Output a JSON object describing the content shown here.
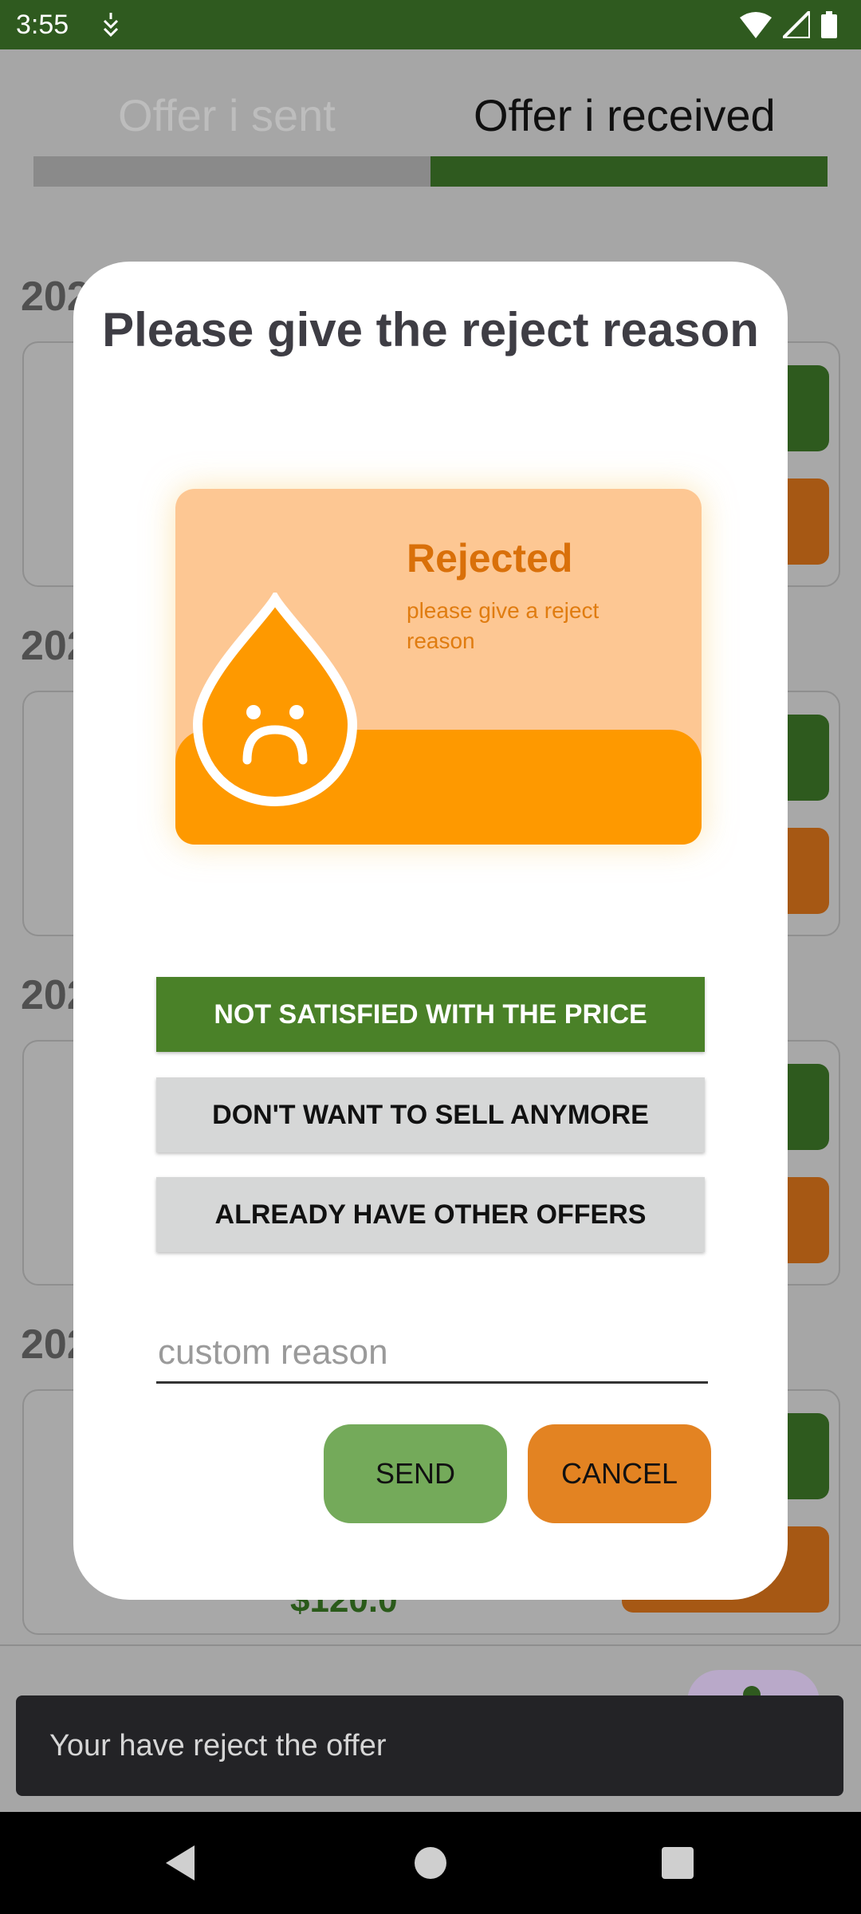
{
  "status_bar": {
    "time": "3:55"
  },
  "tabs": [
    {
      "label": "Offer i sent",
      "active": false
    },
    {
      "label": "Offer i received",
      "active": true
    }
  ],
  "background_cards": {
    "year_labels": [
      "202",
      "202",
      "202",
      "202"
    ],
    "last_price_partial": "$120.0"
  },
  "dialog": {
    "title": "Please give the reject reason",
    "illustration": {
      "title": "Rejected",
      "subtitle": "please give a reject reason"
    },
    "options": [
      {
        "label": "NOT SATISFIED WITH THE PRICE",
        "selected": true
      },
      {
        "label": "DON'T WANT TO SELL ANYMORE",
        "selected": false
      },
      {
        "label": "ALREADY HAVE OTHER OFFERS",
        "selected": false
      }
    ],
    "custom_reason": {
      "value": "",
      "placeholder": "custom reason"
    },
    "send_label": "SEND",
    "cancel_label": "CANCEL"
  },
  "snackbar": {
    "message": "Your have reject the offer"
  },
  "colors": {
    "primary_green": "#4a8128",
    "dark_green": "#2f5a1f",
    "cancel_orange": "#e38322",
    "illustration_orange": "#fe9900"
  }
}
